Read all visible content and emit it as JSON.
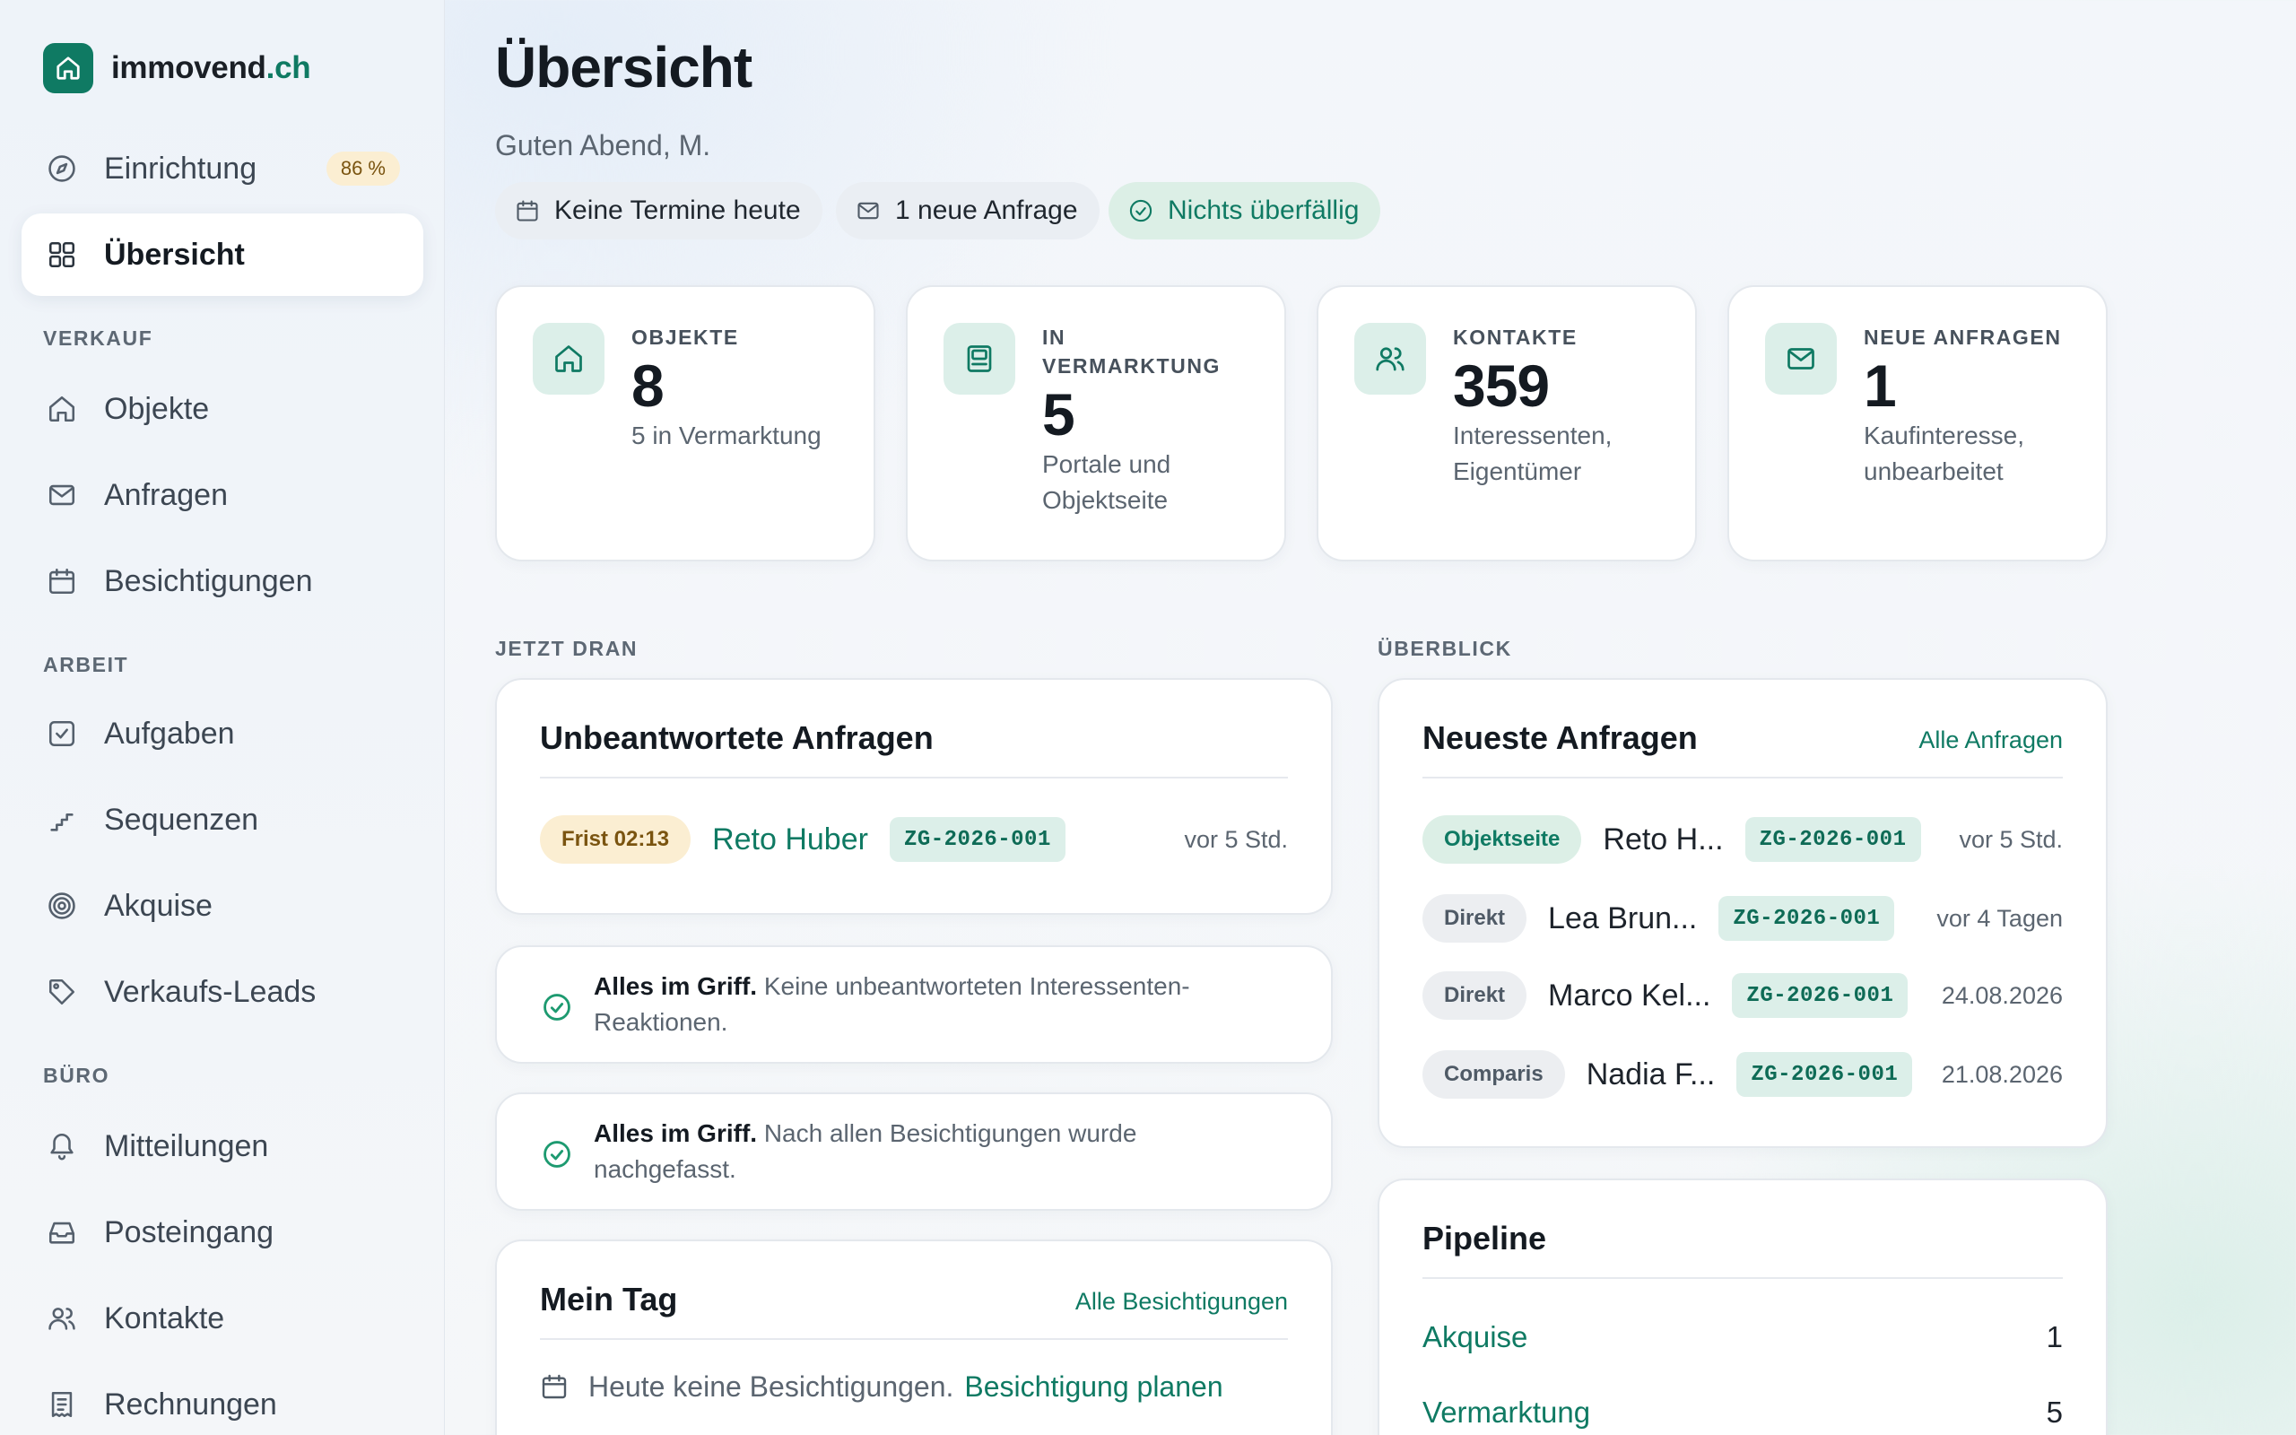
{
  "brand": {
    "name": "immovend",
    "tld": ".ch"
  },
  "sidebar": {
    "setup": {
      "label": "Einrichtung",
      "badge": "86 %"
    },
    "overview": {
      "label": "Übersicht"
    },
    "sections": {
      "sales": "VERKAUF",
      "work": "ARBEIT",
      "office": "BÜRO"
    },
    "sales_items": [
      "Objekte",
      "Anfragen",
      "Besichtigungen"
    ],
    "work_items": [
      "Aufgaben",
      "Sequenzen",
      "Akquise",
      "Verkaufs-Leads"
    ],
    "office_items": [
      "Mitteilungen",
      "Posteingang",
      "Kontakte",
      "Rechnungen"
    ]
  },
  "header": {
    "title": "Übersicht",
    "greeting": "Guten Abend, M.",
    "pills": {
      "appointments": "Keine Termine heute",
      "inquiries": "1 neue Anfrage",
      "overdue": "Nichts überfällig"
    }
  },
  "stats": [
    {
      "label": "OBJEKTE",
      "value": "8",
      "sub": "5 in Vermarktung"
    },
    {
      "label": "IN VERMARKTUNG",
      "value": "5",
      "sub": "Portale und Objektseite"
    },
    {
      "label": "KONTAKTE",
      "value": "359",
      "sub": "Interessenten, Eigentümer"
    },
    {
      "label": "NEUE ANFRAGEN",
      "value": "1",
      "sub": "Kaufinteresse, unbearbeitet"
    }
  ],
  "sections": {
    "now": "JETZT DRAN",
    "overview": "ÜBERBLICK"
  },
  "unanswered": {
    "title": "Unbeantwortete Anfragen",
    "row": {
      "deadline": "Frist 02:13",
      "name": "Reto Huber",
      "ref": "ZG-2026-001",
      "time": "vor 5 Std."
    }
  },
  "notes": [
    {
      "bold": "Alles im Griff.",
      "text": " Keine unbeantworteten Interessenten-Reaktionen."
    },
    {
      "bold": "Alles im Griff.",
      "text": " Nach allen Besichtigungen wurde nachgefasst."
    }
  ],
  "my_day": {
    "title": "Mein Tag",
    "link": "Alle Besichtigungen",
    "empty": "Heute keine Besichtigungen.",
    "action": "Besichtigung planen"
  },
  "latest": {
    "title": "Neueste Anfragen",
    "link": "Alle Anfragen",
    "rows": [
      {
        "source": "Objektseite",
        "name": "Reto H...",
        "ref": "ZG-2026-001",
        "time": "vor 5 Std."
      },
      {
        "source": "Direkt",
        "name": "Lea Brun...",
        "ref": "ZG-2026-001",
        "time": "vor 4 Tagen"
      },
      {
        "source": "Direkt",
        "name": "Marco Kel...",
        "ref": "ZG-2026-001",
        "time": "24.08.2026"
      },
      {
        "source": "Comparis",
        "name": "Nadia F...",
        "ref": "ZG-2026-001",
        "time": "21.08.2026"
      }
    ]
  },
  "pipeline": {
    "title": "Pipeline",
    "rows": [
      {
        "label": "Akquise",
        "count": "1"
      },
      {
        "label": "Vermarktung",
        "count": "5"
      }
    ]
  },
  "colors": {
    "accent": "#0f7a63",
    "accent_bg": "#dcefe9",
    "warn_bg": "#fbeed2",
    "warn_fg": "#7a5410"
  }
}
